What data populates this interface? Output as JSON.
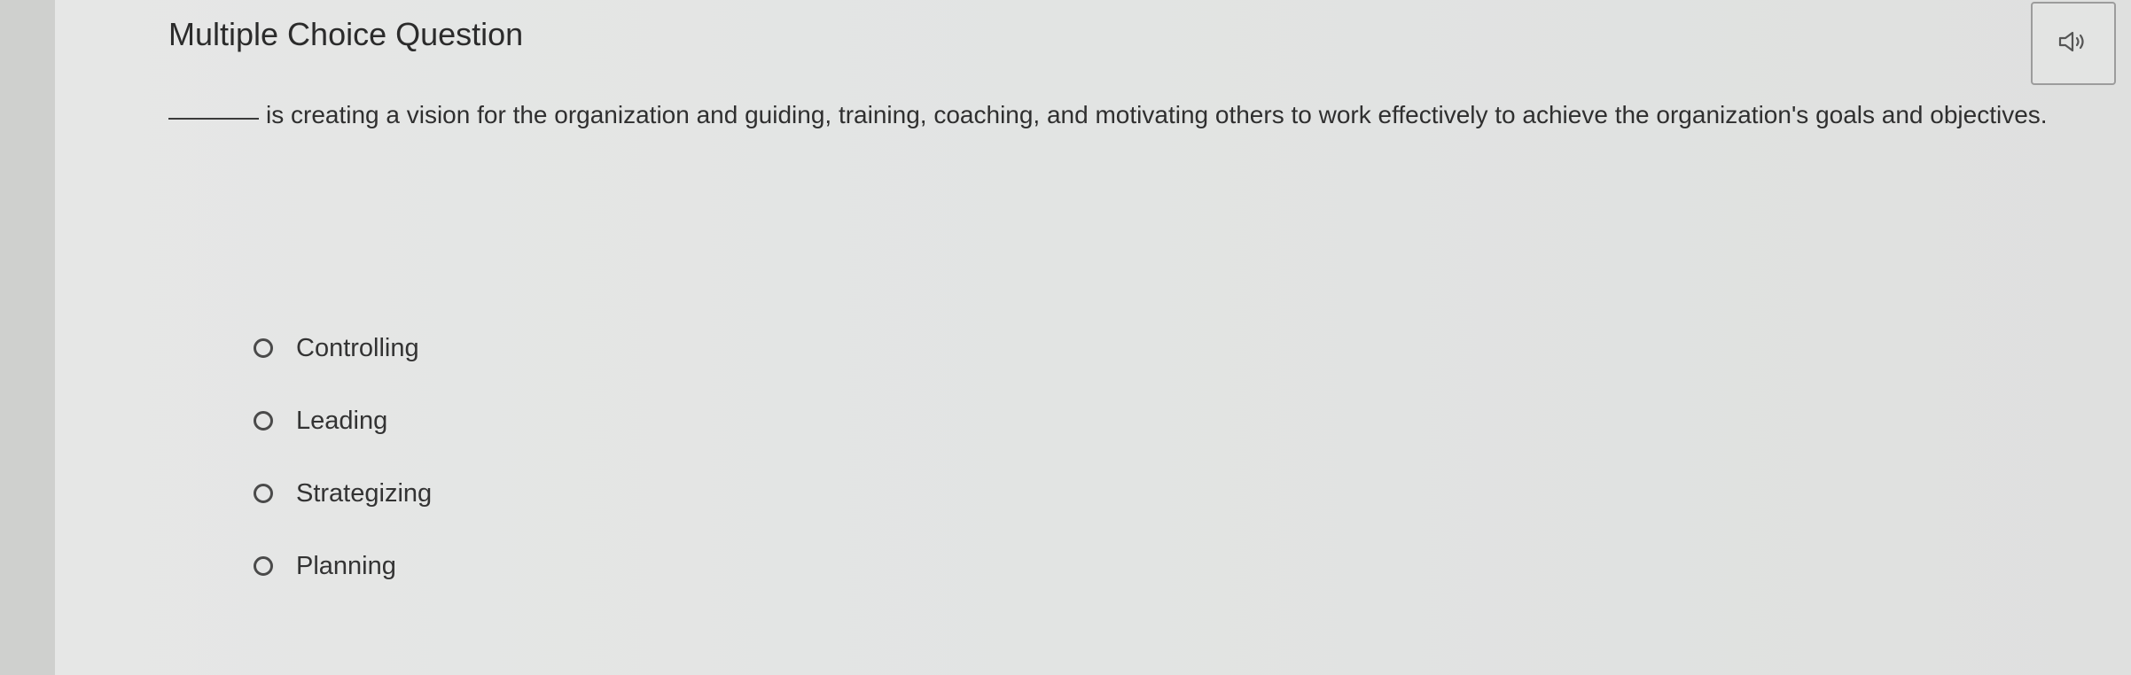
{
  "question": {
    "title": "Multiple Choice Question",
    "prompt_text": "is creating a vision for the organization and guiding, training, coaching, and motivating others to work effectively to achieve the organization's goals and objectives.",
    "blank": "_______",
    "audio_icon": "speaker-icon"
  },
  "options": [
    {
      "label": "Controlling",
      "selected": false
    },
    {
      "label": "Leading",
      "selected": false
    },
    {
      "label": "Strategizing",
      "selected": false
    },
    {
      "label": "Planning",
      "selected": false
    }
  ]
}
